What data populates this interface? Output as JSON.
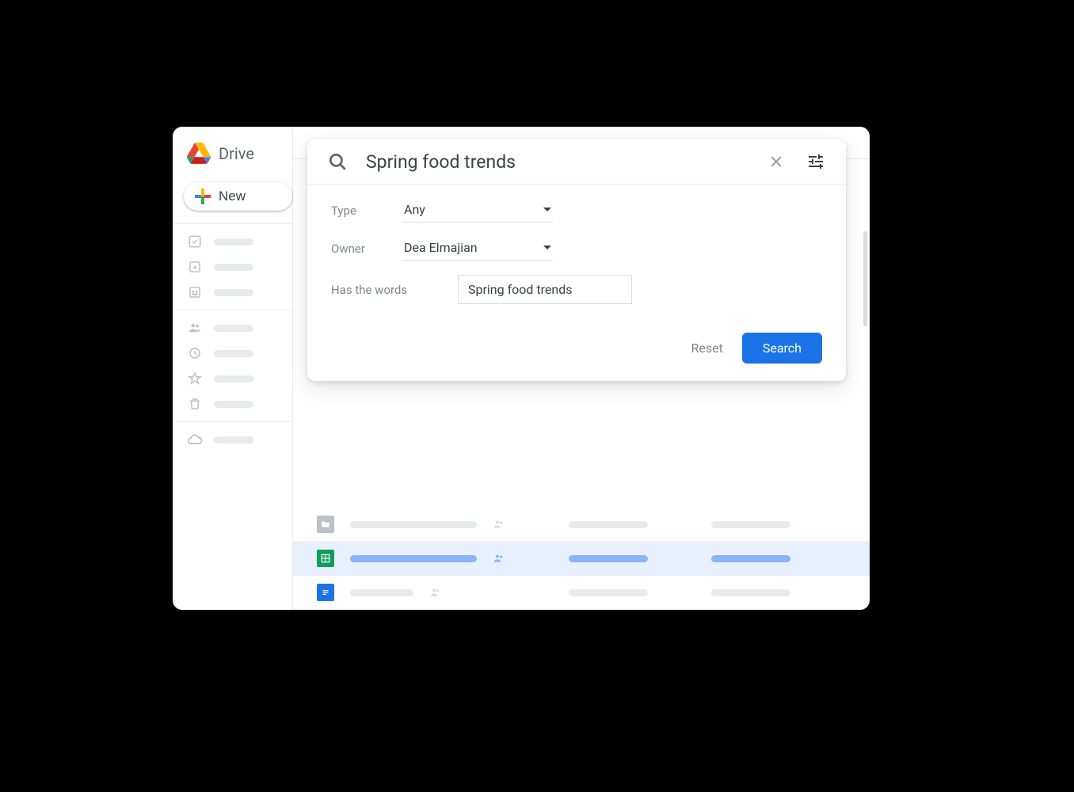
{
  "app": {
    "title": "Drive"
  },
  "sidebar": {
    "new_label": "New"
  },
  "search": {
    "query": "Spring food trends",
    "filters": {
      "type_label": "Type",
      "type_value": "Any",
      "owner_label": "Owner",
      "owner_value": "Dea Elmajian",
      "words_label": "Has the words",
      "words_value": "Spring food trends"
    },
    "actions": {
      "reset": "Reset",
      "search": "Search"
    }
  },
  "files": {
    "rows": [
      {
        "type": "folder",
        "selected": false
      },
      {
        "type": "sheets",
        "selected": true
      },
      {
        "type": "docs",
        "selected": false
      }
    ]
  }
}
